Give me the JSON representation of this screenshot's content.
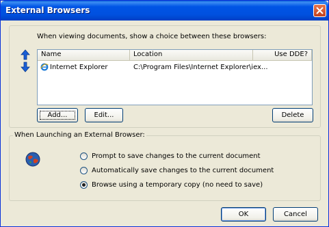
{
  "window": {
    "title": "External Browsers"
  },
  "browsers_group": {
    "prompt": "When viewing documents, show a choice between these browsers:",
    "columns": [
      "Name",
      "Location",
      "Use DDE?"
    ],
    "rows": [
      {
        "name": "Internet Explorer",
        "location": "C:\\Program Files\\Internet Explorer\\iex...",
        "use_dde": ""
      }
    ],
    "buttons": {
      "add": "Add...",
      "edit": "Edit...",
      "delete": "Delete"
    }
  },
  "launch_group": {
    "legend": "When Launching an External Browser:",
    "options": [
      {
        "label": "Prompt to save changes to the current document",
        "checked": false
      },
      {
        "label": "Automatically save changes to the current document",
        "checked": false
      },
      {
        "label": "Browse using a temporary copy (no need to save)",
        "checked": true
      }
    ]
  },
  "footer": {
    "ok": "OK",
    "cancel": "Cancel"
  },
  "icons": [
    "close-icon",
    "move-up-arrow-icon",
    "move-down-arrow-icon",
    "internet-explorer-icon",
    "globe-icon"
  ]
}
